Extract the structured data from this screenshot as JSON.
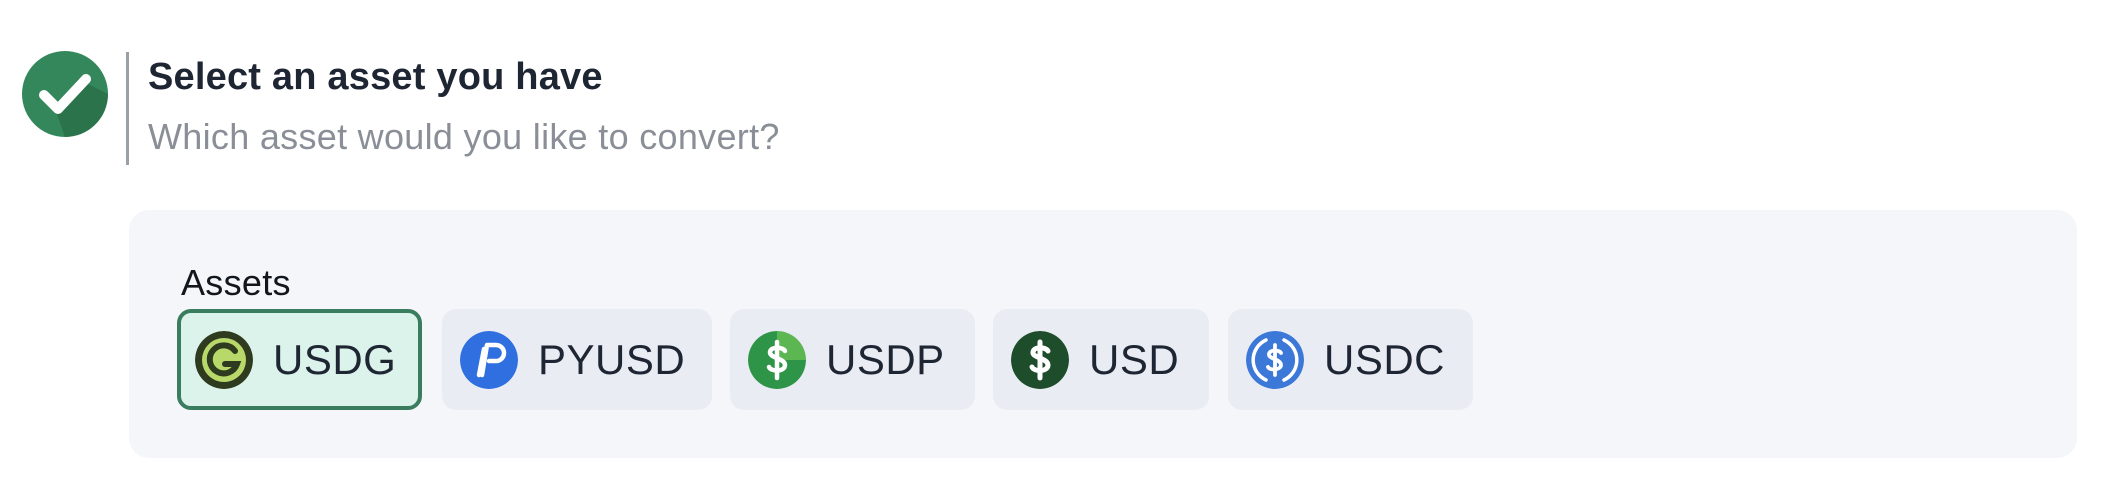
{
  "step": {
    "title": "Select an asset you have",
    "subtitle": "Which asset would you like to convert?",
    "status_icon": "check-circle-icon"
  },
  "assets": {
    "label": "Assets",
    "selected": "USDG",
    "items": [
      {
        "symbol": "USDG",
        "icon": "usdg-icon",
        "color": "#b8d86a",
        "selected": true
      },
      {
        "symbol": "PYUSD",
        "icon": "pyusd-icon",
        "color": "#2f6fe0",
        "selected": false
      },
      {
        "symbol": "USDP",
        "icon": "usdp-icon",
        "color": "#2e9447",
        "selected": false
      },
      {
        "symbol": "USD",
        "icon": "usd-icon",
        "color": "#1e4d2b",
        "selected": false
      },
      {
        "symbol": "USDC",
        "icon": "usdc-icon",
        "color": "#3b78d8",
        "selected": false
      }
    ]
  },
  "colors": {
    "accent": "#3a7d5e",
    "panel_background": "#f5f6fa",
    "chip_background": "#e9ecf3",
    "selected_chip_background": "#dcf3ec"
  }
}
